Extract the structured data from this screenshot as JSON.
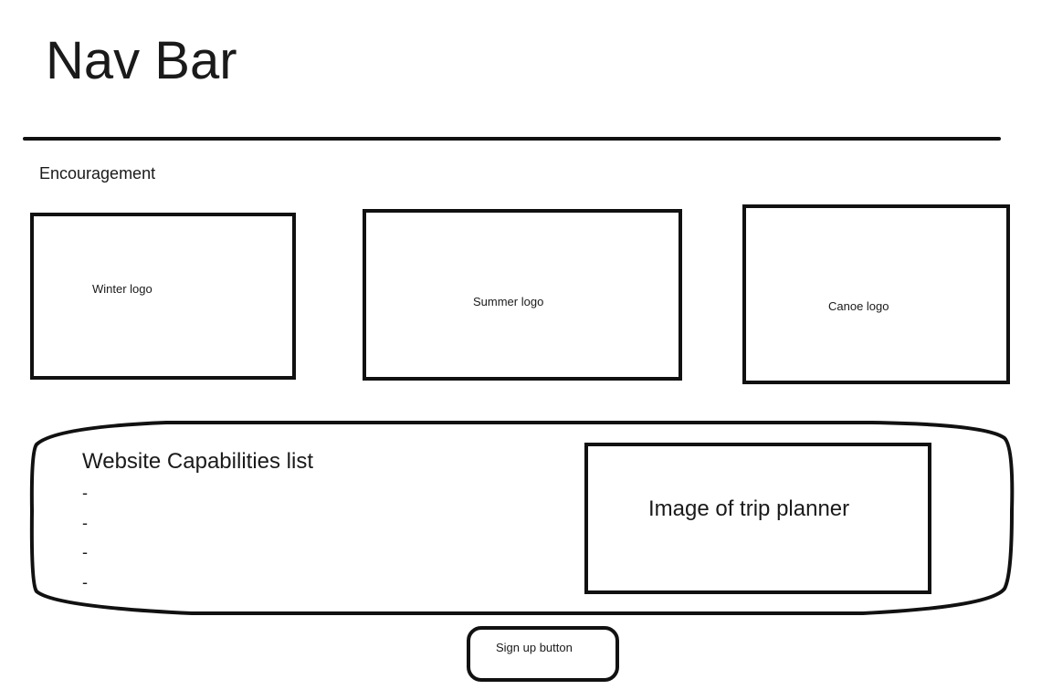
{
  "nav": {
    "title": "Nav Bar"
  },
  "encouragement": {
    "text": "Encouragement"
  },
  "logos": [
    {
      "label": "Winter logo"
    },
    {
      "label": "Summer logo"
    },
    {
      "label": "Canoe logo"
    }
  ],
  "capabilities": {
    "title": "Website Capabilities list",
    "items": [
      "-",
      "-",
      "-",
      "-"
    ],
    "image_label": "Image of trip planner"
  },
  "signup": {
    "label": "Sign up button"
  },
  "colors": {
    "stroke": "#111111",
    "text": "#1a1a1a",
    "background": "#ffffff"
  }
}
